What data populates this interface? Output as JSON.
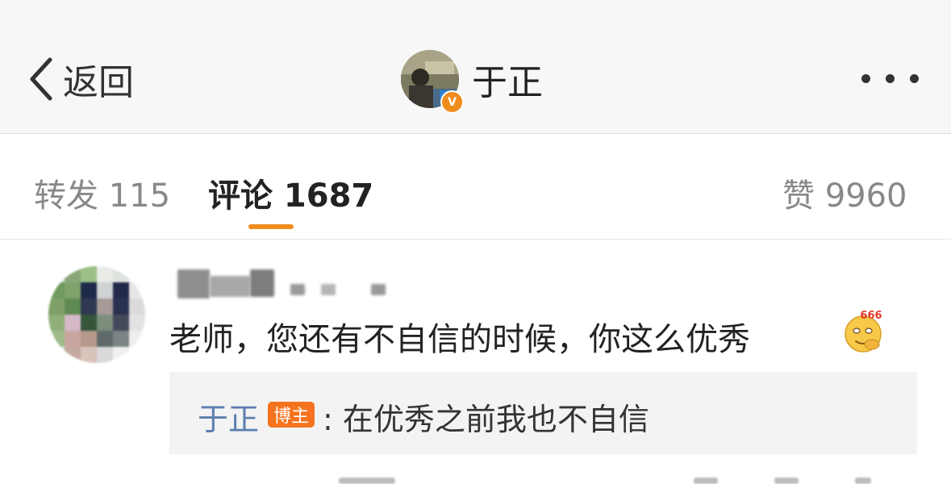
{
  "nav": {
    "back_label": "返回",
    "profile_name": "于正",
    "verified_badge": "V",
    "icons": [
      "chevron-left-icon",
      "verified-icon",
      "more-icon"
    ]
  },
  "tabs": {
    "repost": "转发 115",
    "comments": "评论 1687",
    "likes": "赞 9960"
  },
  "comment": {
    "text": "老师，您还有不自信的时候，你这么优秀",
    "emoji": "666",
    "reply": {
      "author": "于正",
      "badge": "博主",
      "text": ": 在优秀之前我也不自信"
    }
  },
  "colors": {
    "accent": "#f08c1d",
    "link": "#5b7eaf",
    "badge": "#f5731f"
  }
}
